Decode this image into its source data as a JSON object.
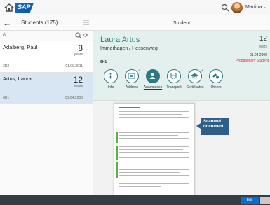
{
  "shell": {
    "logo_text": "SAP",
    "user_name": "Martina"
  },
  "list": {
    "title": "Students (175)",
    "search_value": "A",
    "items": [
      {
        "name": "Adalberg, Paul",
        "age": "8",
        "unit": "years",
        "code": "3R2",
        "date": "01.09.2011",
        "selected": false
      },
      {
        "name": "Artus, Laura",
        "age": "12",
        "unit": "years",
        "code": "6H1",
        "date": "01.04.2008",
        "selected": true
      }
    ]
  },
  "detail": {
    "header_title": "Student",
    "name": "Laura Artus",
    "address": "Immerhagen / Hessenweg",
    "group": "6H1",
    "age": "12",
    "age_unit": "years",
    "date": "01.04.2008",
    "status": "Probationary Student",
    "status_color": "#d92b2b",
    "accent_color": "#2b7a86",
    "tabs": [
      {
        "label": "Info",
        "icon": "info-icon",
        "badge": ""
      },
      {
        "label": "Address",
        "icon": "address-card-icon",
        "badge": "3"
      },
      {
        "label": "Anamneses",
        "icon": "person-icon",
        "badge": ""
      },
      {
        "label": "Transport",
        "icon": "bus-icon",
        "badge": ""
      },
      {
        "label": "Certificates",
        "icon": "graduation-cap-icon",
        "badge": "2"
      },
      {
        "label": "Others",
        "icon": "pills-icon",
        "badge": ""
      }
    ],
    "callout": "Scanned document"
  },
  "footer": {
    "edit_label": "Edit"
  }
}
